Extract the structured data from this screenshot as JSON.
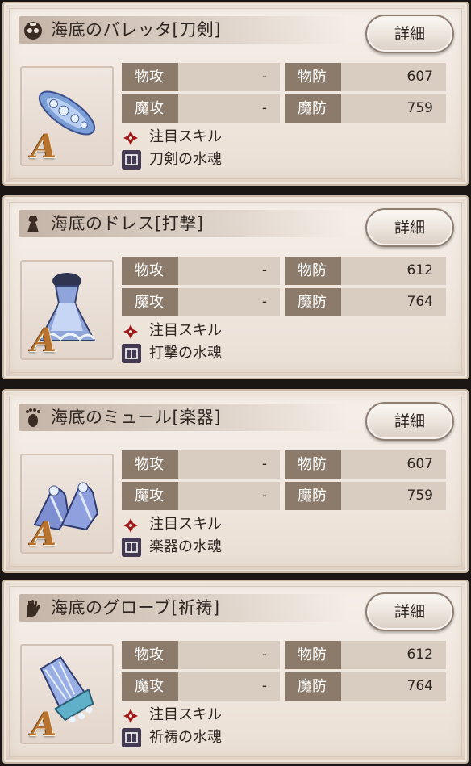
{
  "cards": [
    {
      "title": "海底のバレッタ[刀剣]",
      "title_icon": "head-icon",
      "detail_label": "詳細",
      "rank": "A",
      "item_icon": "barrette-icon",
      "patk_label": "物攻",
      "patk_value": "-",
      "pdef_label": "物防",
      "pdef_value": "607",
      "matk_label": "魔攻",
      "matk_value": "-",
      "mdef_label": "魔防",
      "mdef_value": "759",
      "skill_label": "注目スキル",
      "soul_label": "刀剣の水魂"
    },
    {
      "title": "海底のドレス[打撃]",
      "title_icon": "body-icon",
      "detail_label": "詳細",
      "rank": "A",
      "item_icon": "dress-icon",
      "patk_label": "物攻",
      "patk_value": "-",
      "pdef_label": "物防",
      "pdef_value": "612",
      "matk_label": "魔攻",
      "matk_value": "-",
      "mdef_label": "魔防",
      "mdef_value": "764",
      "skill_label": "注目スキル",
      "soul_label": "打撃の水魂"
    },
    {
      "title": "海底のミュール[楽器]",
      "title_icon": "foot-icon",
      "detail_label": "詳細",
      "rank": "A",
      "item_icon": "mule-icon",
      "patk_label": "物攻",
      "patk_value": "-",
      "pdef_label": "物防",
      "pdef_value": "607",
      "matk_label": "魔攻",
      "matk_value": "-",
      "mdef_label": "魔防",
      "mdef_value": "759",
      "skill_label": "注目スキル",
      "soul_label": "楽器の水魂"
    },
    {
      "title": "海底のグローブ[祈祷]",
      "title_icon": "hand-icon",
      "detail_label": "詳細",
      "rank": "A",
      "item_icon": "glove-icon",
      "patk_label": "物攻",
      "patk_value": "-",
      "pdef_label": "物防",
      "pdef_value": "612",
      "matk_label": "魔攻",
      "matk_value": "-",
      "mdef_label": "魔防",
      "mdef_value": "764",
      "skill_label": "注目スキル",
      "soul_label": "祈祷の水魂"
    }
  ],
  "colors": {
    "label_bg": "#8c7a6a",
    "value_bg": "#d9ccc0",
    "rank": "#b7722e",
    "skill_icon": "#a01818"
  }
}
